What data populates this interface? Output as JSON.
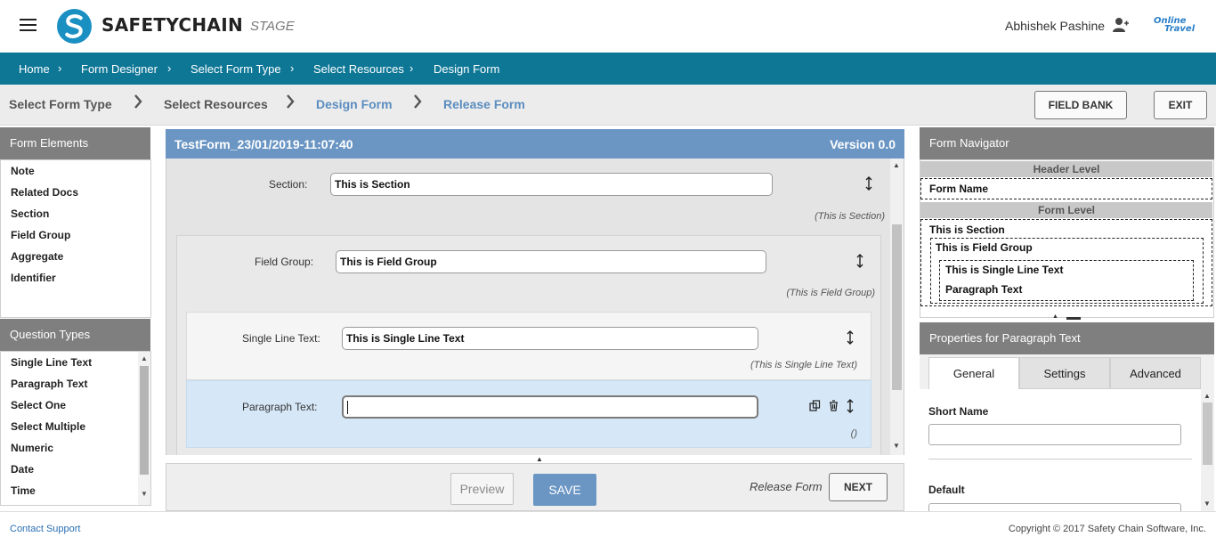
{
  "header": {
    "logo_text": "SAFETYCHAIN",
    "env_label": "STAGE",
    "username": "Abhishek Pashine",
    "brand_line1": "Online",
    "brand_line2": "Travel"
  },
  "breadcrumb": [
    "Home",
    "Form Designer",
    "Select Form Type",
    "Select Resources",
    "Design Form"
  ],
  "steps": [
    "Select Form Type",
    "Select Resources",
    "Design Form",
    "Release Form"
  ],
  "toolbar": {
    "field_bank": "FIELD BANK",
    "exit": "EXIT"
  },
  "form_elements": {
    "title": "Form Elements",
    "items": [
      "Note",
      "Related Docs",
      "Section",
      "Field Group",
      "Aggregate",
      "Identifier"
    ]
  },
  "question_types": {
    "title": "Question Types",
    "items": [
      "Single Line Text",
      "Paragraph Text",
      "Select One",
      "Select Multiple",
      "Numeric",
      "Date",
      "Time"
    ]
  },
  "form": {
    "name": "TestForm_23/01/2019-11:07:40",
    "version": "Version 0.0",
    "section": {
      "label": "Section:",
      "value": "This is Section",
      "caption": "(This is Section)"
    },
    "field_group": {
      "label": "Field Group:",
      "value": "This is Field Group",
      "caption": "(This is Field Group)"
    },
    "single_line": {
      "label": "Single Line Text:",
      "value": "This is Single Line Text",
      "caption": "(This is Single Line Text)"
    },
    "paragraph": {
      "label": "Paragraph Text:",
      "value": "",
      "caption": "()"
    }
  },
  "actions": {
    "preview": "Preview",
    "save": "SAVE",
    "release_form": "Release Form",
    "next": "NEXT"
  },
  "navigator": {
    "title": "Form Navigator",
    "header_level": "Header Level",
    "form_name": "Form Name",
    "form_level": "Form Level",
    "section": "This is Section",
    "field_group": "This is Field Group",
    "single_line": "This is Single Line Text",
    "paragraph": "Paragraph Text"
  },
  "properties": {
    "title": "Properties for Paragraph Text",
    "tabs": [
      "General",
      "Settings",
      "Advanced"
    ],
    "short_name_label": "Short Name",
    "short_name_value": "",
    "default_label": "Default"
  },
  "footer": {
    "contact": "Contact Support",
    "copyright": "Copyright © 2017 Safety Chain Software, Inc."
  },
  "colors": {
    "breadcrumb_bg": "#0e7796",
    "form_header_bg": "#6b96c4",
    "panel_head_bg": "#7f7f7f",
    "selected_row_bg": "#d6e8f8"
  }
}
